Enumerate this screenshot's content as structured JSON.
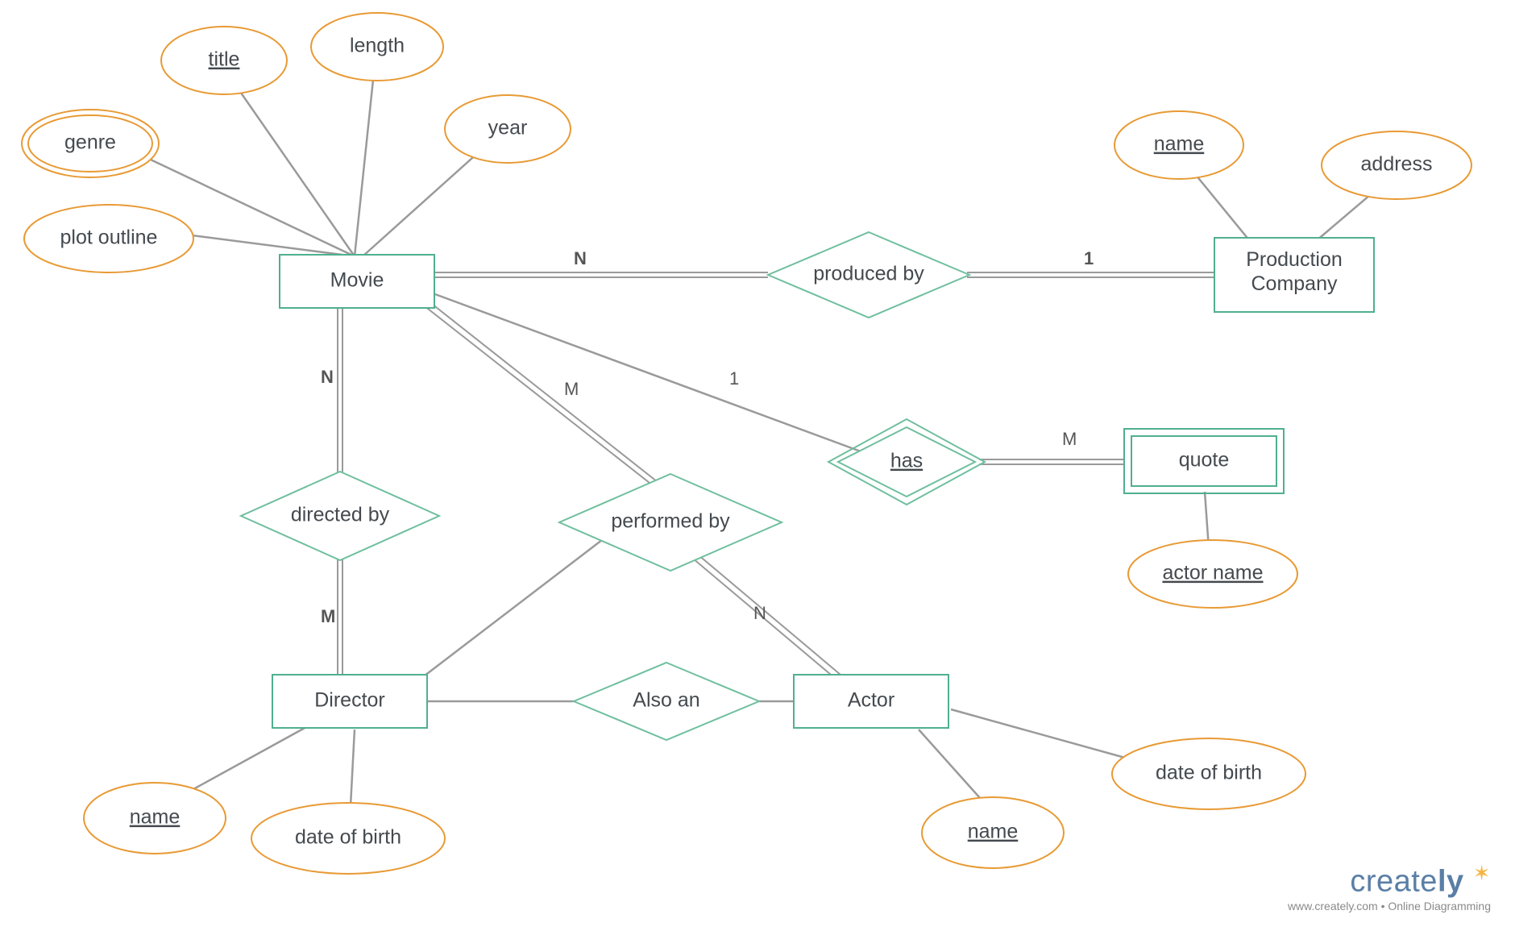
{
  "entities": {
    "movie": "Movie",
    "production_company_l1": "Production",
    "production_company_l2": "Company",
    "director": "Director",
    "actor": "Actor",
    "quote": "quote"
  },
  "relationships": {
    "produced_by": "produced by",
    "directed_by": "directed by",
    "performed_by": "performed by",
    "has": "has",
    "also_an": "Also an"
  },
  "attributes": {
    "genre": "genre",
    "title": "title",
    "length": "length",
    "year": "year",
    "plot_outline": "plot outline",
    "pc_name": "name",
    "pc_address": "address",
    "actor_name_q": "actor name",
    "dir_name": "name",
    "dir_dob": "date of birth",
    "act_name": "name",
    "act_dob": "date of birth"
  },
  "cardinalities": {
    "movie_produced": "N",
    "pc_produced": "1",
    "movie_directed": "N",
    "dir_directed": "M",
    "movie_performed": "M",
    "actor_performed": "N",
    "movie_has": "1",
    "quote_has": "M"
  },
  "watermark": {
    "brand_pre": "create",
    "brand_post": "ly",
    "sub": "www.creately.com • Online Diagramming"
  }
}
